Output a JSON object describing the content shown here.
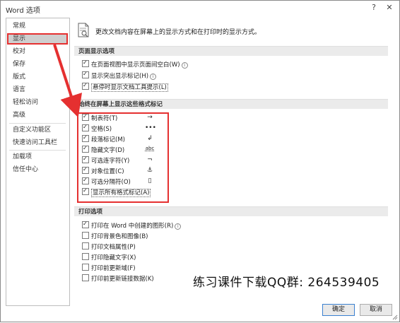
{
  "window": {
    "title": "Word 选项"
  },
  "sidebar": {
    "items": [
      {
        "label": "常规"
      },
      {
        "label": "显示"
      },
      {
        "label": "校对"
      },
      {
        "label": "保存"
      },
      {
        "label": "版式"
      },
      {
        "label": "语言"
      },
      {
        "label": "轻松访问"
      },
      {
        "label": "高级"
      },
      {
        "label": "自定义功能区"
      },
      {
        "label": "快速访问工具栏"
      },
      {
        "label": "加载项"
      },
      {
        "label": "信任中心"
      }
    ],
    "selected": "显示"
  },
  "header": {
    "text": "更改文档内容在屏幕上的显示方式和在打印时的显示方式。",
    "icon": "document-display-icon"
  },
  "page_display": {
    "title": "页面显示选项",
    "options": [
      {
        "label": "在页面视图中显示页面间空白(W)",
        "checked": true
      },
      {
        "label": "显示突出显示标记(H)",
        "checked": true
      },
      {
        "label": "悬停时显示文档工具提示(L)",
        "checked": true
      }
    ]
  },
  "formatting_marks": {
    "title": "始终在屏幕上显示这些格式标记",
    "options": [
      {
        "label": "制表符(T)",
        "symbol": "→",
        "checked": true
      },
      {
        "label": "空格(S)",
        "symbol": "•••",
        "checked": true
      },
      {
        "label": "段落标记(M)",
        "symbol": "↲",
        "checked": true
      },
      {
        "label": "隐藏文字(D)",
        "symbol": "abc",
        "checked": true
      },
      {
        "label": "可选连字符(Y)",
        "symbol": "¬",
        "checked": true
      },
      {
        "label": "对象位置(C)",
        "symbol": "⚓",
        "checked": true
      },
      {
        "label": "可选分隔符(O)",
        "symbol": "▯",
        "checked": true
      },
      {
        "label": "显示所有格式标记(A)",
        "checked": true
      }
    ]
  },
  "print_options": {
    "title": "打印选项",
    "options": [
      {
        "label": "打印在 Word 中创建的图形(R)",
        "checked": true
      },
      {
        "label": "打印背景色和图像(B)",
        "checked": false
      },
      {
        "label": "打印文档属性(P)",
        "checked": false
      },
      {
        "label": "打印隐藏文字(X)",
        "checked": false
      },
      {
        "label": "打印前更新域(F)",
        "checked": false
      },
      {
        "label": "打印前更新链接数据(K)",
        "checked": false
      }
    ]
  },
  "watermark": "练习课件下载QQ群: 264539405",
  "buttons": {
    "ok": "确定",
    "cancel": "取消"
  },
  "titlebar_buttons": {
    "help": "?",
    "close": "✕"
  },
  "colors": {
    "highlight": "#e53030",
    "selected_bg": "#cfcfcf",
    "section_bg": "#ebebeb"
  }
}
